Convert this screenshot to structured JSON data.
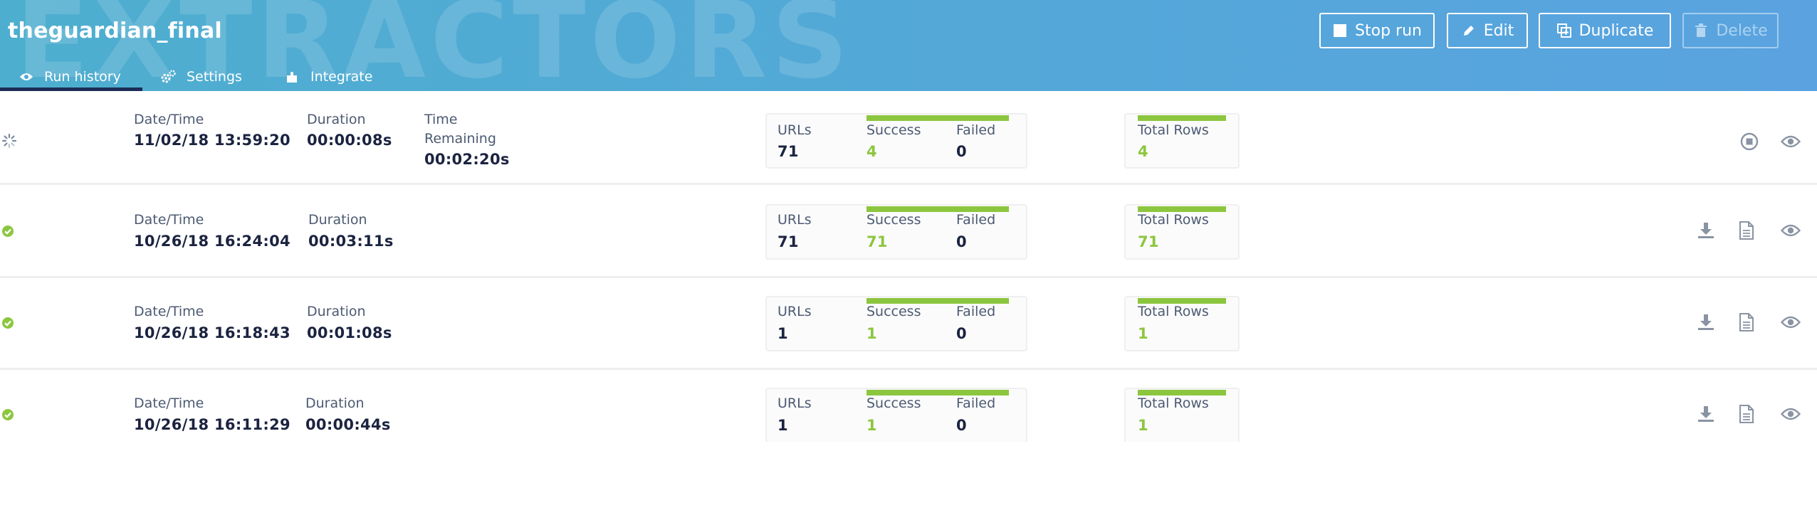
{
  "header": {
    "watermark": "EXTRACTORS",
    "title": "theguardian_final",
    "buttons": {
      "stop_run": "Stop run",
      "edit": "Edit",
      "duplicate": "Duplicate",
      "delete": "Delete"
    },
    "tabs": [
      {
        "label": "Run history",
        "icon": "eye-icon",
        "active": true
      },
      {
        "label": "Settings",
        "icon": "gears-icon",
        "active": false
      },
      {
        "label": "Integrate",
        "icon": "puzzle-icon",
        "active": false
      }
    ]
  },
  "labels": {
    "datetime": "Date/Time",
    "duration": "Duration",
    "time_remaining_1": "Time",
    "time_remaining_2": "Remaining",
    "urls": "URLs",
    "success": "Success",
    "failed": "Failed",
    "total_rows": "Total Rows"
  },
  "runs": [
    {
      "status": "running",
      "datetime": "11/02/18 13:59:20",
      "duration": "00:00:08s",
      "time_remaining": "00:02:20s",
      "urls": "71",
      "success": "4",
      "failed": "0",
      "total_rows": "4",
      "actions": [
        "stop-icon",
        "eye-icon"
      ]
    },
    {
      "status": "success",
      "datetime": "10/26/18 16:24:04",
      "duration": "00:03:11s",
      "urls": "71",
      "success": "71",
      "failed": "0",
      "total_rows": "71",
      "actions": [
        "download-icon",
        "document-icon",
        "eye-icon"
      ]
    },
    {
      "status": "success",
      "datetime": "10/26/18 16:18:43",
      "duration": "00:01:08s",
      "urls": "1",
      "success": "1",
      "failed": "0",
      "total_rows": "1",
      "actions": [
        "download-icon",
        "document-icon",
        "eye-icon"
      ]
    },
    {
      "status": "success",
      "datetime": "10/26/18 16:11:29",
      "duration": "00:00:44s",
      "urls": "1",
      "success": "1",
      "failed": "0",
      "total_rows": "1",
      "actions": [
        "download-icon",
        "document-icon",
        "eye-icon"
      ]
    }
  ],
  "colors": {
    "accent_green": "#8cc63f",
    "header_blue": "#53a8d8",
    "tab_underline": "#1b2d55"
  }
}
